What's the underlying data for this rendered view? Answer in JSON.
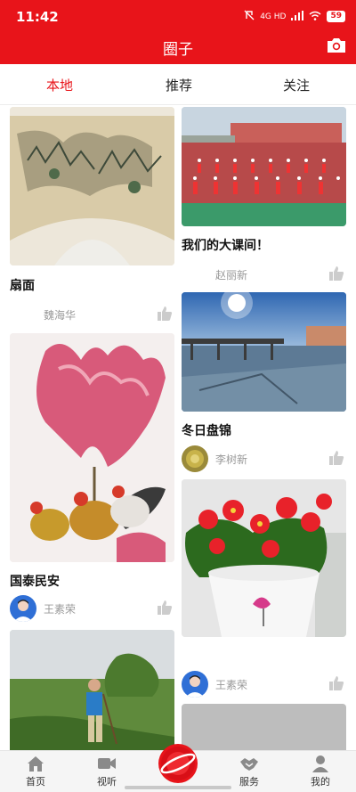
{
  "status": {
    "time": "11:42",
    "network": "4G HD",
    "battery": "59"
  },
  "header": {
    "title": "圈子"
  },
  "tabs": [
    {
      "label": "本地",
      "active": true
    },
    {
      "label": "推荐",
      "active": false
    },
    {
      "label": "关注",
      "active": false
    }
  ],
  "feed": {
    "left": [
      {
        "title": "扇面",
        "author": "魏海华"
      },
      {
        "title": "国泰民安",
        "author": "王素荣"
      }
    ],
    "right": [
      {
        "title": "我们的大课间！",
        "author": "赵丽新"
      },
      {
        "title": "冬日盘锦",
        "author": "李树新"
      },
      {
        "title": "",
        "author": "王素荣"
      }
    ]
  },
  "bottom_nav": [
    {
      "label": "首页",
      "icon": "home-icon"
    },
    {
      "label": "视听",
      "icon": "video-icon"
    },
    {
      "label": "",
      "icon": "planet-icon"
    },
    {
      "label": "服务",
      "icon": "handshake-icon"
    },
    {
      "label": "我的",
      "icon": "person-icon"
    }
  ],
  "colors": {
    "brand": "#e8141a",
    "muted": "#999999"
  }
}
